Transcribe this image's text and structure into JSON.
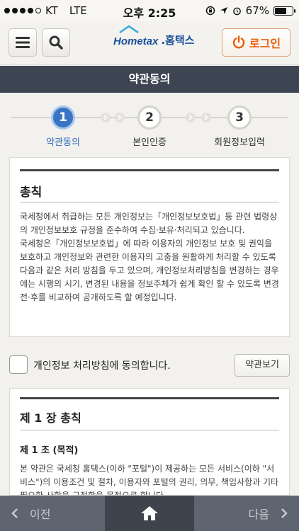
{
  "status_bar": {
    "carrier": "KT",
    "network": "LTE",
    "time": "오후 2:25",
    "battery_percent": "67%",
    "battery_level": 0.67
  },
  "header": {
    "logo_text_en": "Hometax",
    "logo_text_kr": ".홈택스",
    "login_label": "로그인",
    "icons": {
      "menu": "hamburger-icon",
      "search": "magnifier-icon",
      "power": "power-icon"
    }
  },
  "page_title": "약관동의",
  "steps": [
    {
      "number": "1",
      "label": "약관동의",
      "active": true
    },
    {
      "number": "2",
      "label": "본인인증",
      "active": false
    },
    {
      "number": "3",
      "label": "회원정보입력",
      "active": false
    }
  ],
  "privacy_terms": {
    "heading": "총칙",
    "paragraphs": [
      "국세청에서 취급하는 모든 개인정보는「개인정보보호법」등 관련 법령상의 개인정보보호 규정을 준수하여 수집·보유·처리되고 있습니다.",
      "국세청은「개인정보보호법」에 따라 이용자의 개인정보 보호 및 권익을 보호하고 개인정보와 관련한 이용자의 고충을 원활하게 처리할 수 있도록 다음과 같은 처리 방침을 두고 있으며, 개인정보처리방침을 변경하는 경우에는 시행의 시기, 변경된 내용을 정보주체가 쉽게 확인 할 수 있도록 변경 전·후를 비교하여 공개하도록 할 예정입니다."
    ]
  },
  "agree": {
    "label": "개인정보 처리방침에 동의합니다.",
    "view_button": "약관보기"
  },
  "chapter": {
    "heading": "제 1 장 총칙",
    "article_title": "제 1 조 (목적)",
    "body": "본 약관은 국세청 홈택스(이하 \"포털\")이 제공하는 모든 서비스(이하 \"서비스\")의 이용조건 및 절차, 이용자와 포털의 권리, 의무, 책임사항과 기타 필요한 사항을 규정함을 목적으로 합니다."
  },
  "bottom_nav": {
    "prev_label": "이전",
    "next_label": "다음",
    "home_icon": "home-icon"
  }
}
